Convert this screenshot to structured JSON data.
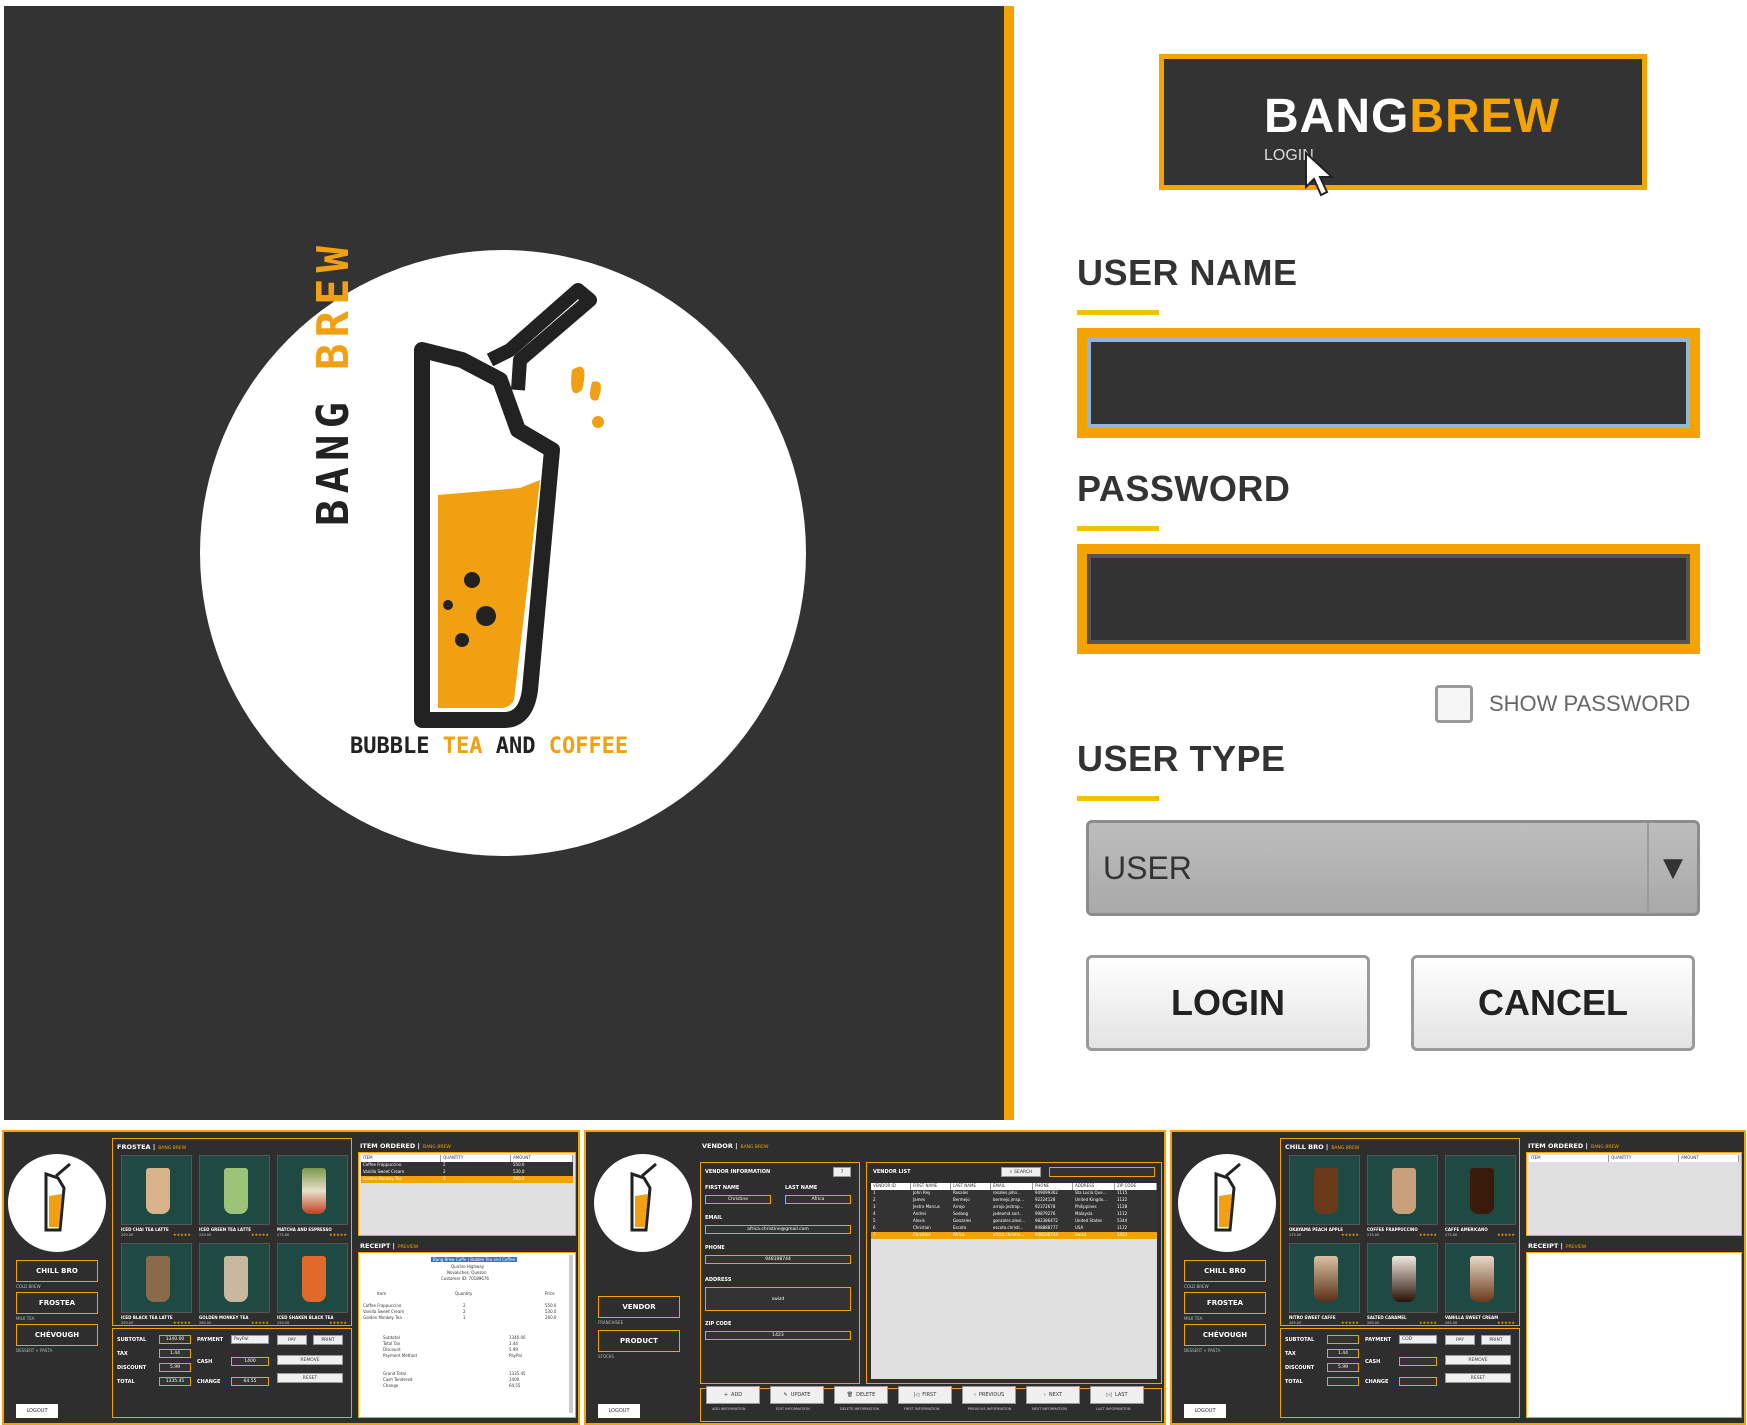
{
  "login": {
    "brand": {
      "part1": "BANG",
      "part2": "BREW",
      "subtitle": "LOGIN"
    },
    "logo": {
      "word1": "BANG",
      "word2": "BREW",
      "tagline_part1": "BUBBLE ",
      "tagline_part2": "TEA",
      "tagline_part3": " AND ",
      "tagline_part4": "COFFEE"
    },
    "username_label": "USER NAME",
    "username_value": "",
    "password_label": "PASSWORD",
    "password_value": "",
    "show_password_label": "SHOW PASSWORD",
    "show_password_checked": false,
    "user_type_label": "USER TYPE",
    "user_type_value": "USER",
    "login_button": "LOGIN",
    "cancel_button": "CANCEL",
    "colors": {
      "accent": "#f5a300",
      "dark": "#333333"
    }
  },
  "thumb_frostea": {
    "nav": [
      {
        "label": "CHILL BRO",
        "sub": "COLD BREW"
      },
      {
        "label": "FROSTEA",
        "sub": "MILK TEA"
      },
      {
        "label": "CHÉVOUGH",
        "sub": "DESSERT + PASTA"
      }
    ],
    "logout": "LOGOUT",
    "section_title": "FROSTEA |",
    "section_sub": "BANG BREW",
    "products": [
      {
        "name": "ICED CHAI TEA LATTE",
        "price": "250.00"
      },
      {
        "name": "ICED GREEN TEA LATTE",
        "price": "220.00"
      },
      {
        "name": "MATCHA AND ESPRESSO",
        "price": "275.00"
      },
      {
        "name": "ICED BLACK TEA LATTE",
        "price": "250.00"
      },
      {
        "name": "GOLDEN MONKEY TEA",
        "price": "260.00"
      },
      {
        "name": "ICED SHAKEN BLACK TEA",
        "price": "250.00"
      }
    ],
    "item_ordered_title": "ITEM ORDERED |",
    "item_ordered_sub": "BANG BREW",
    "order_headers": [
      "ITEM",
      "QUANTITY",
      "AMOUNT"
    ],
    "order_rows": [
      [
        "Coffee Frappuccino",
        "2",
        "550.0"
      ],
      [
        "Vanilla Sweet Cream",
        "2",
        "530.0"
      ],
      [
        "Golden Monkey Tea",
        "1",
        "260.0"
      ]
    ],
    "receipt_title": "RECEIPT |",
    "receipt_sub": "PREVIEW",
    "receipt_lines": [
      "Bang Brew Coffe | Bubble Tea and Coffee",
      "Quirino Highway",
      "Novaliches, Quezon",
      "Customer ID: 70189676"
    ],
    "receipt_item_header": [
      "Item",
      "Quantity",
      "Price"
    ],
    "receipt_items": [
      [
        "Coffee Frappuccino",
        "2",
        "550.0"
      ],
      [
        "Vanilla Sweet Cream",
        "2",
        "530.0"
      ],
      [
        "Golden Monkey Tea",
        "1",
        "260.0"
      ]
    ],
    "receipt_totals": [
      [
        "Subtotal",
        "1340.00"
      ],
      [
        "Total Tax",
        "1.44"
      ],
      [
        "Discount",
        "5.99"
      ],
      [
        "Payment Method",
        "PayPal"
      ]
    ],
    "receipt_grand": [
      [
        "Grand Total",
        "1335.45"
      ],
      [
        "Cash Tendered",
        "1400"
      ],
      [
        "Change",
        "64.55"
      ]
    ],
    "subtotal_label": "SUBTOTAL",
    "subtotal_value": "1340.00",
    "tax_label": "TAX",
    "tax_value": "1.44",
    "discount_label": "DISCOUNT",
    "discount_value": "5.99",
    "total_label": "TOTAL",
    "total_value": "1335.45",
    "payment_label": "PAYMENT",
    "payment_value": "PayPal",
    "cash_label": "CASH",
    "cash_value": "1400",
    "change_label": "CHANGE",
    "change_value": "64.55",
    "pay_button": "PAY",
    "print_button": "PRINT",
    "remove_button": "REMOVE",
    "reset_button": "RESET"
  },
  "thumb_vendor": {
    "nav": [
      {
        "label": "VENDOR",
        "sub": "FRANCHISEE"
      },
      {
        "label": "PRODUCT",
        "sub": "STOCKS"
      }
    ],
    "logout": "LOGOUT",
    "section_title": "VENDOR |",
    "section_sub": "BANG BREW",
    "info_title": "VENDOR INFORMATION",
    "id_value": "7",
    "first_name_label": "FIRST NAME",
    "first_name_value": "Christine",
    "last_name_label": "LAST NAME",
    "last_name_value": "Africa",
    "email_label": "EMAIL",
    "email_value": "africa.christine@gmail.com",
    "phone_label": "PHONE",
    "phone_value": "948198744",
    "address_label": "ADDRESS",
    "address_value": "swizd",
    "zip_label": "ZIP CODE",
    "zip_value": "1423",
    "list_title": "VENDOR LIST",
    "search_button": "SEARCH",
    "list_headers": [
      "VENDOR ID",
      "FIRST NAME",
      "LAST NAME",
      "EMAIL",
      "PHONE",
      "ADDRESS",
      "ZIP CODE"
    ],
    "list_rows": [
      [
        "1",
        "John Rey",
        "Rosales",
        "rosales.john...",
        "949099362",
        "Sta Lucia Que...",
        "1115"
      ],
      [
        "2",
        "James",
        "Bermejo",
        "bermejo.jmsp...",
        "92224128",
        "United Kingdo...",
        "1122"
      ],
      [
        "3",
        "Jestro Marcus",
        "Arrojo",
        "arrojo.jestrop...",
        "92372678",
        "Philippines",
        "1128"
      ],
      [
        "4",
        "Andrei",
        "Sodang",
        "jadeomd.sod...",
        "99879276",
        "Malaysia",
        "1112"
      ],
      [
        "5",
        "Alexis",
        "Gonzales",
        "gonzales.alexi...",
        "982386472",
        "United States",
        "5344"
      ],
      [
        "6",
        "Christian",
        "Escoto",
        "escoto.christi...",
        "948888777",
        "USA",
        "1122"
      ],
      [
        "7",
        "Christine",
        "Africa",
        "africa.christin...",
        "948198744",
        "swizd",
        "1423"
      ]
    ],
    "action_buttons": [
      {
        "label": "ADD",
        "caption": "ADD INFORMATION"
      },
      {
        "label": "UPDATE",
        "caption": "EDIT INFORMATION"
      },
      {
        "label": "DELETE",
        "caption": "DELETE INFORMATION"
      },
      {
        "label": "FIRST",
        "caption": "FIRST INFORMATION"
      },
      {
        "label": "PREVIOUS",
        "caption": "PREVIOUS INFORMATION"
      },
      {
        "label": "NEXT",
        "caption": "NEXT INFORMATION"
      },
      {
        "label": "LAST",
        "caption": "LAST INFORMATION"
      }
    ]
  },
  "thumb_chillbro": {
    "nav": [
      {
        "label": "CHILL BRO",
        "sub": "COLD BREW"
      },
      {
        "label": "FROSTEA",
        "sub": "MILK TEA"
      },
      {
        "label": "CHÉVOUGH",
        "sub": "DESSERT + PASTA"
      }
    ],
    "logout": "LOGOUT",
    "section_title": "CHILL BRO |",
    "section_sub": "BANG BREW",
    "products": [
      {
        "name": "OKAYAMA PEACH APPLE",
        "price": "275.00"
      },
      {
        "name": "COFFEE FRAPPUCCINO",
        "price": "275.00"
      },
      {
        "name": "CAFFE AMERICANO",
        "price": "275.00"
      },
      {
        "name": "NITRO SWEET CAFFE",
        "price": "265.00"
      },
      {
        "name": "SALTED CARAMEL",
        "price": "265.00"
      },
      {
        "name": "VANILLA SWEET CREAM",
        "price": "265.00"
      }
    ],
    "item_ordered_title": "ITEM ORDERED |",
    "item_ordered_sub": "BANG BREW",
    "order_headers": [
      "ITEM",
      "QUANTITY",
      "AMOUNT"
    ],
    "receipt_title": "RECEIPT |",
    "receipt_sub": "PREVIEW",
    "subtotal_label": "SUBTOTAL",
    "subtotal_value": "",
    "tax_label": "TAX",
    "tax_value": "1.44",
    "discount_label": "DISCOUNT",
    "discount_value": "5.99",
    "total_label": "TOTAL",
    "total_value": "",
    "payment_label": "PAYMENT",
    "payment_value": "COD",
    "cash_label": "CASH",
    "cash_value": "",
    "change_label": "CHANGE",
    "change_value": "",
    "pay_button": "PAY",
    "print_button": "PRINT",
    "remove_button": "REMOVE",
    "reset_button": "RESET"
  }
}
